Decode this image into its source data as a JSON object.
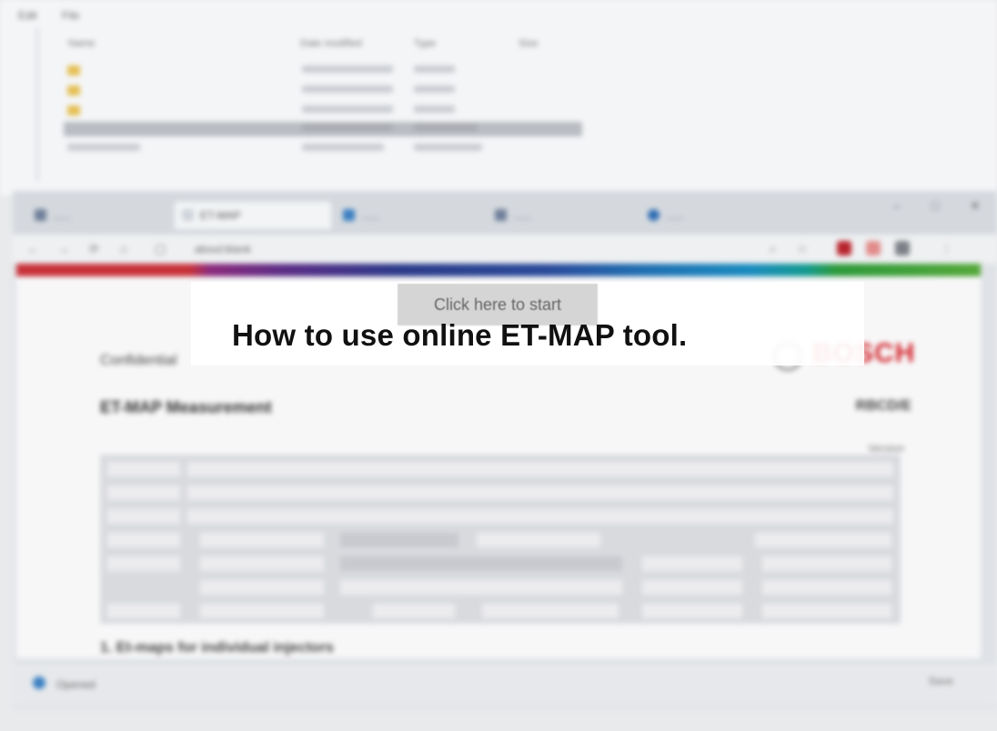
{
  "explorer": {
    "menu": [
      "Edit",
      "File"
    ],
    "columns": [
      "Name",
      "Date modified",
      "Type",
      "Size"
    ],
    "rows": [
      {
        "name": "..."
      },
      {
        "name": "..."
      },
      {
        "name": "..."
      },
      {
        "name": "..."
      },
      {
        "name": "..."
      }
    ]
  },
  "browser": {
    "tabs": [
      {
        "label": "......"
      },
      {
        "label": "ET-MAP"
      },
      {
        "label": "......"
      },
      {
        "label": "......"
      },
      {
        "label": "......"
      }
    ],
    "url": "about:blank",
    "window_controls": {
      "minimize": "–",
      "maximize": "□",
      "close": "✕"
    },
    "page": {
      "header_small": "Confidential",
      "doc_title": "ET-MAP Measurement",
      "doc_code": "RBCD/E",
      "brand": "BOSCH",
      "version": "Version",
      "section_heading": "1. Et-maps for individual injectors"
    },
    "status": {
      "text": "Opened",
      "button": "Save"
    }
  },
  "overlay": {
    "start_button": "Click here to start",
    "headline": "How to use online ET-MAP tool."
  },
  "colors": {
    "brand_red": "#d2232a",
    "headline": "#111111",
    "button_bg": "#d5d5d5"
  }
}
